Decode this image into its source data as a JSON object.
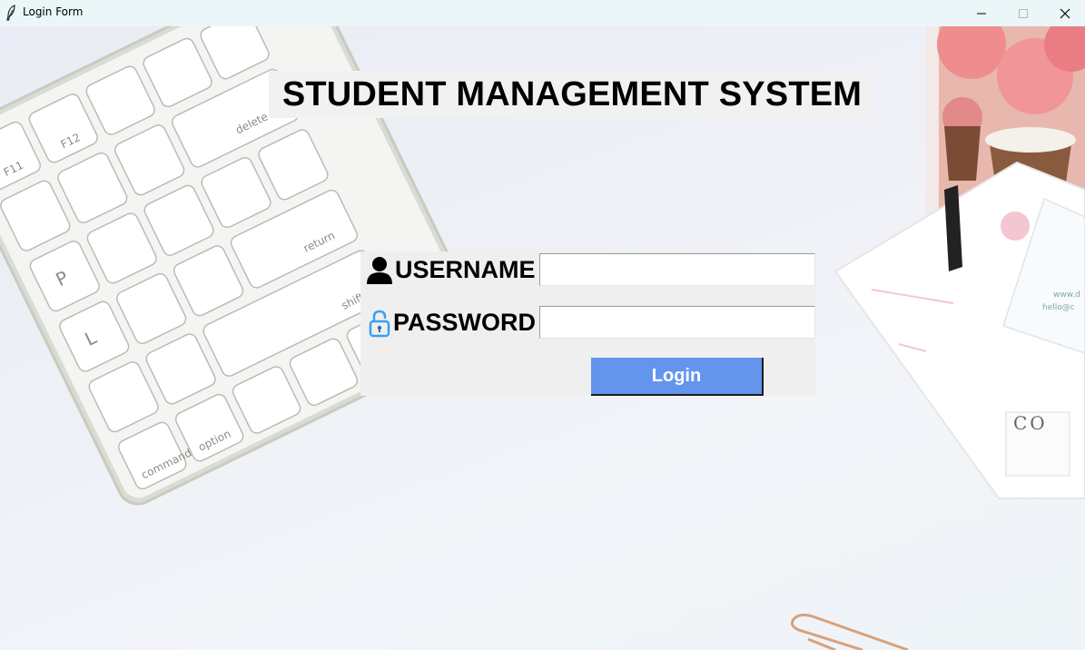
{
  "window": {
    "title": "Login Form",
    "controls": [
      "minimize-icon",
      "maximize-icon",
      "close-icon"
    ]
  },
  "heading": "STUDENT MANAGEMENT SYSTEM",
  "form": {
    "username": {
      "label": "USERNAME",
      "value": "",
      "icon": "user-icon"
    },
    "password": {
      "label": "PASSWORD",
      "value": "",
      "icon": "lock-icon"
    },
    "login_label": "Login"
  },
  "background": {
    "keyboard_keys": [
      "F11",
      "F12",
      "delete",
      "return",
      "shift",
      "command",
      "option",
      "P",
      "L"
    ],
    "card_text": [
      "CO",
      "www.d",
      "hello@c"
    ]
  },
  "colors": {
    "titlebar": "#eaf6f8",
    "login_button": "#6495ed",
    "lock_icon": "#3aa0f0"
  }
}
